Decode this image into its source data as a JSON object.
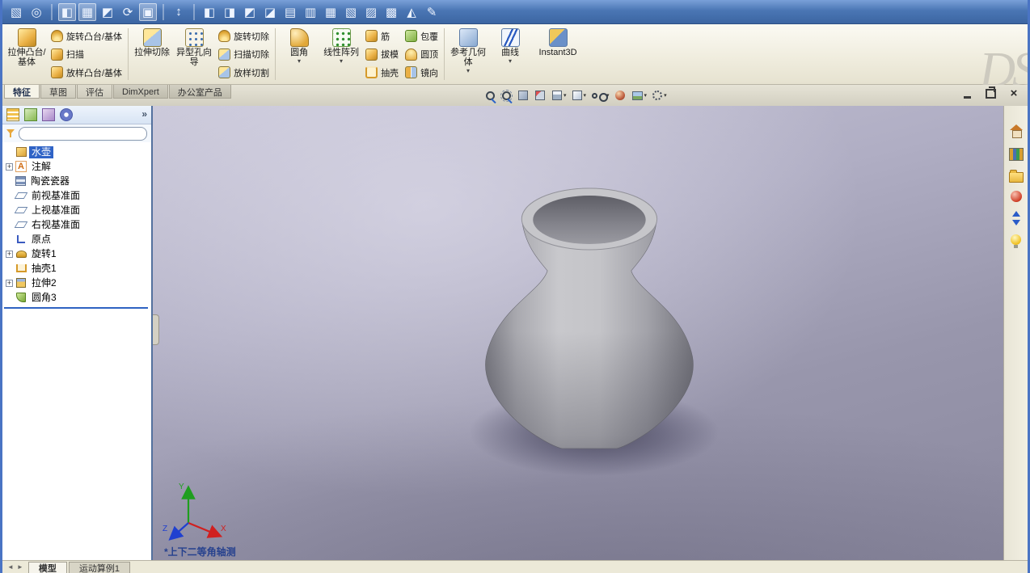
{
  "glyphs": {
    "dropdown": "▾",
    "overflow": "»",
    "close": "×",
    "tab_prev": "◄",
    "tab_next": "►"
  },
  "top_toolbar": {
    "icons": [
      {
        "name": "sketch-tool-icon",
        "glyph": "▧",
        "cls": ""
      },
      {
        "name": "globe-icon",
        "glyph": "◎",
        "cls": ""
      },
      {
        "name": "separator",
        "glyph": "",
        "cls": "ttsep"
      },
      {
        "name": "single-viewport-icon",
        "glyph": "◧",
        "cls": "pressed"
      },
      {
        "name": "multi-viewport-icon",
        "glyph": "▦",
        "cls": "pressed"
      },
      {
        "name": "shaded-display-icon",
        "glyph": "◩",
        "cls": ""
      },
      {
        "name": "rebuild-icon",
        "glyph": "⟳",
        "cls": ""
      },
      {
        "name": "fullscreen-icon",
        "glyph": "▣",
        "cls": "pressed"
      },
      {
        "name": "separator",
        "glyph": "",
        "cls": "ttsep"
      },
      {
        "name": "measure-icon",
        "glyph": "↕",
        "cls": ""
      },
      {
        "name": "separator",
        "glyph": "",
        "cls": "ttsep"
      },
      {
        "name": "view-front-icon",
        "glyph": "◧",
        "cls": ""
      },
      {
        "name": "view-back-icon",
        "glyph": "◨",
        "cls": ""
      },
      {
        "name": "view-left-icon",
        "glyph": "◩",
        "cls": ""
      },
      {
        "name": "view-right-icon",
        "glyph": "◪",
        "cls": ""
      },
      {
        "name": "view-top-icon",
        "glyph": "▤",
        "cls": ""
      },
      {
        "name": "view-bottom-icon",
        "glyph": "▥",
        "cls": ""
      },
      {
        "name": "view-isometric-icon",
        "glyph": "▦",
        "cls": ""
      },
      {
        "name": "view-dimetric-icon",
        "glyph": "▧",
        "cls": ""
      },
      {
        "name": "view-trimetric-icon",
        "glyph": "▨",
        "cls": ""
      },
      {
        "name": "view-normal-to-icon",
        "glyph": "▩",
        "cls": ""
      },
      {
        "name": "section-view-icon",
        "glyph": "◭",
        "cls": ""
      },
      {
        "name": "sketch-pencil-icon",
        "glyph": "✎",
        "cls": ""
      }
    ]
  },
  "ribbon": {
    "extruded_boss": "拉伸凸台/基体",
    "revolved_boss": "旋转凸台/基体",
    "sweep": "扫描",
    "lofted_boss": "放样凸台/基体",
    "extruded_cut": "拉伸切除",
    "hole_wizard": "异型孔向导",
    "revolved_cut": "旋转切除",
    "swept_cut": "扫描切除",
    "lofted_cut": "放样切割",
    "fillet": "圆角",
    "linear_pattern": "线性阵列",
    "rib": "筋",
    "draft": "拔模",
    "shell": "抽壳",
    "wrap": "包覆",
    "dome": "圆顶",
    "mirror": "镜向",
    "reference_geometry": "参考几何体",
    "curves": "曲线",
    "instant3d": "Instant3D",
    "watermark": "DS"
  },
  "tabs": {
    "items": [
      {
        "name": "tab-features",
        "label": "特征",
        "cls": "on"
      },
      {
        "name": "tab-sketch",
        "label": "草图",
        "cls": ""
      },
      {
        "name": "tab-evaluate",
        "label": "评估",
        "cls": ""
      },
      {
        "name": "tab-dimxpert",
        "label": "DimXpert",
        "cls": "grp"
      },
      {
        "name": "tab-office-products",
        "label": "办公室产品",
        "cls": "grp"
      }
    ]
  },
  "headsup": {
    "icons": [
      {
        "name": "zoom-fit-icon",
        "cls": "hu-mag",
        "dd": ""
      },
      {
        "name": "zoom-area-icon",
        "cls": "hu-magbox",
        "dd": ""
      },
      {
        "name": "previous-view-icon",
        "cls": "hu-prev",
        "dd": ""
      },
      {
        "name": "section-view-icon",
        "cls": "hu-section",
        "dd": ""
      },
      {
        "name": "view-orientation-icon",
        "cls": "hu-cube",
        "dd": "▾"
      },
      {
        "name": "display-style-icon",
        "cls": "hu-cube2",
        "dd": "▾"
      },
      {
        "name": "hide-show-items-icon",
        "cls": "hu-glasses",
        "dd": "▾"
      },
      {
        "name": "edit-appearance-icon",
        "cls": "hu-ball",
        "dd": ""
      },
      {
        "name": "apply-scene-icon",
        "cls": "hu-scene",
        "dd": "▾"
      },
      {
        "name": "view-settings-icon",
        "cls": "hu-settings",
        "dd": "▾"
      }
    ]
  },
  "tree": {
    "panel_tabs": [
      {
        "name": "featuremanager-tab",
        "cls": "pt-feature"
      },
      {
        "name": "propertymanager-tab",
        "cls": "pt-property"
      },
      {
        "name": "configurationmanager-tab",
        "cls": "pt-config"
      },
      {
        "name": "dimxpertmanager-tab",
        "cls": "pt-dimxpert"
      }
    ],
    "filter_value": "",
    "items": [
      {
        "name": "tree-item-part",
        "label": "水壶",
        "icon": "ti-part",
        "row": "sel",
        "exp": "",
        "glyph": ""
      },
      {
        "name": "tree-item-annotations",
        "label": "注解",
        "icon": "ti-annot",
        "row": "",
        "exp": "+",
        "glyph": "A"
      },
      {
        "name": "tree-item-material",
        "label": "陶瓷瓷器",
        "icon": "ti-material",
        "row": "",
        "exp": "",
        "glyph": ""
      },
      {
        "name": "tree-item-front-plane",
        "label": "前视基准面",
        "icon": "ti-plane",
        "row": "",
        "exp": "",
        "glyph": ""
      },
      {
        "name": "tree-item-top-plane",
        "label": "上视基准面",
        "icon": "ti-plane",
        "row": "",
        "exp": "",
        "glyph": ""
      },
      {
        "name": "tree-item-right-plane",
        "label": "右视基准面",
        "icon": "ti-plane",
        "row": "",
        "exp": "",
        "glyph": ""
      },
      {
        "name": "tree-item-origin",
        "label": "原点",
        "icon": "ti-origin",
        "row": "",
        "exp": "",
        "glyph": ""
      },
      {
        "name": "tree-item-revolve1",
        "label": "旋转1",
        "icon": "ti-revolve",
        "row": "",
        "exp": "+",
        "glyph": ""
      },
      {
        "name": "tree-item-shell1",
        "label": "抽壳1",
        "icon": "ti-shell",
        "row": "",
        "exp": "",
        "glyph": ""
      },
      {
        "name": "tree-item-extrude2",
        "label": "拉伸2",
        "icon": "ti-extrude",
        "row": "",
        "exp": "+",
        "glyph": ""
      },
      {
        "name": "tree-item-fillet3",
        "label": "圆角3",
        "icon": "ti-fillet",
        "row": "",
        "exp": "",
        "glyph": ""
      }
    ]
  },
  "viewport": {
    "view_label": "*上下二等角轴测",
    "triad": {
      "x": "X",
      "y": "Y",
      "z": "Z"
    }
  },
  "taskpane": {
    "icons": [
      {
        "name": "resources-home-icon",
        "cls": "tp-home"
      },
      {
        "name": "design-library-icon",
        "cls": "tp-lib"
      },
      {
        "name": "file-explorer-icon",
        "cls": "tp-folder"
      },
      {
        "name": "appearances-icon",
        "cls": "tp-ball"
      },
      {
        "name": "custom-properties-icon",
        "cls": "tp-props"
      },
      {
        "name": "render-tools-icon",
        "cls": "tp-bulb"
      }
    ]
  },
  "statusbar": {
    "tabs": [
      {
        "name": "model-tab",
        "label": "模型",
        "cls": "on"
      },
      {
        "name": "motion-study1-tab",
        "label": "运动算例1",
        "cls": ""
      }
    ]
  }
}
